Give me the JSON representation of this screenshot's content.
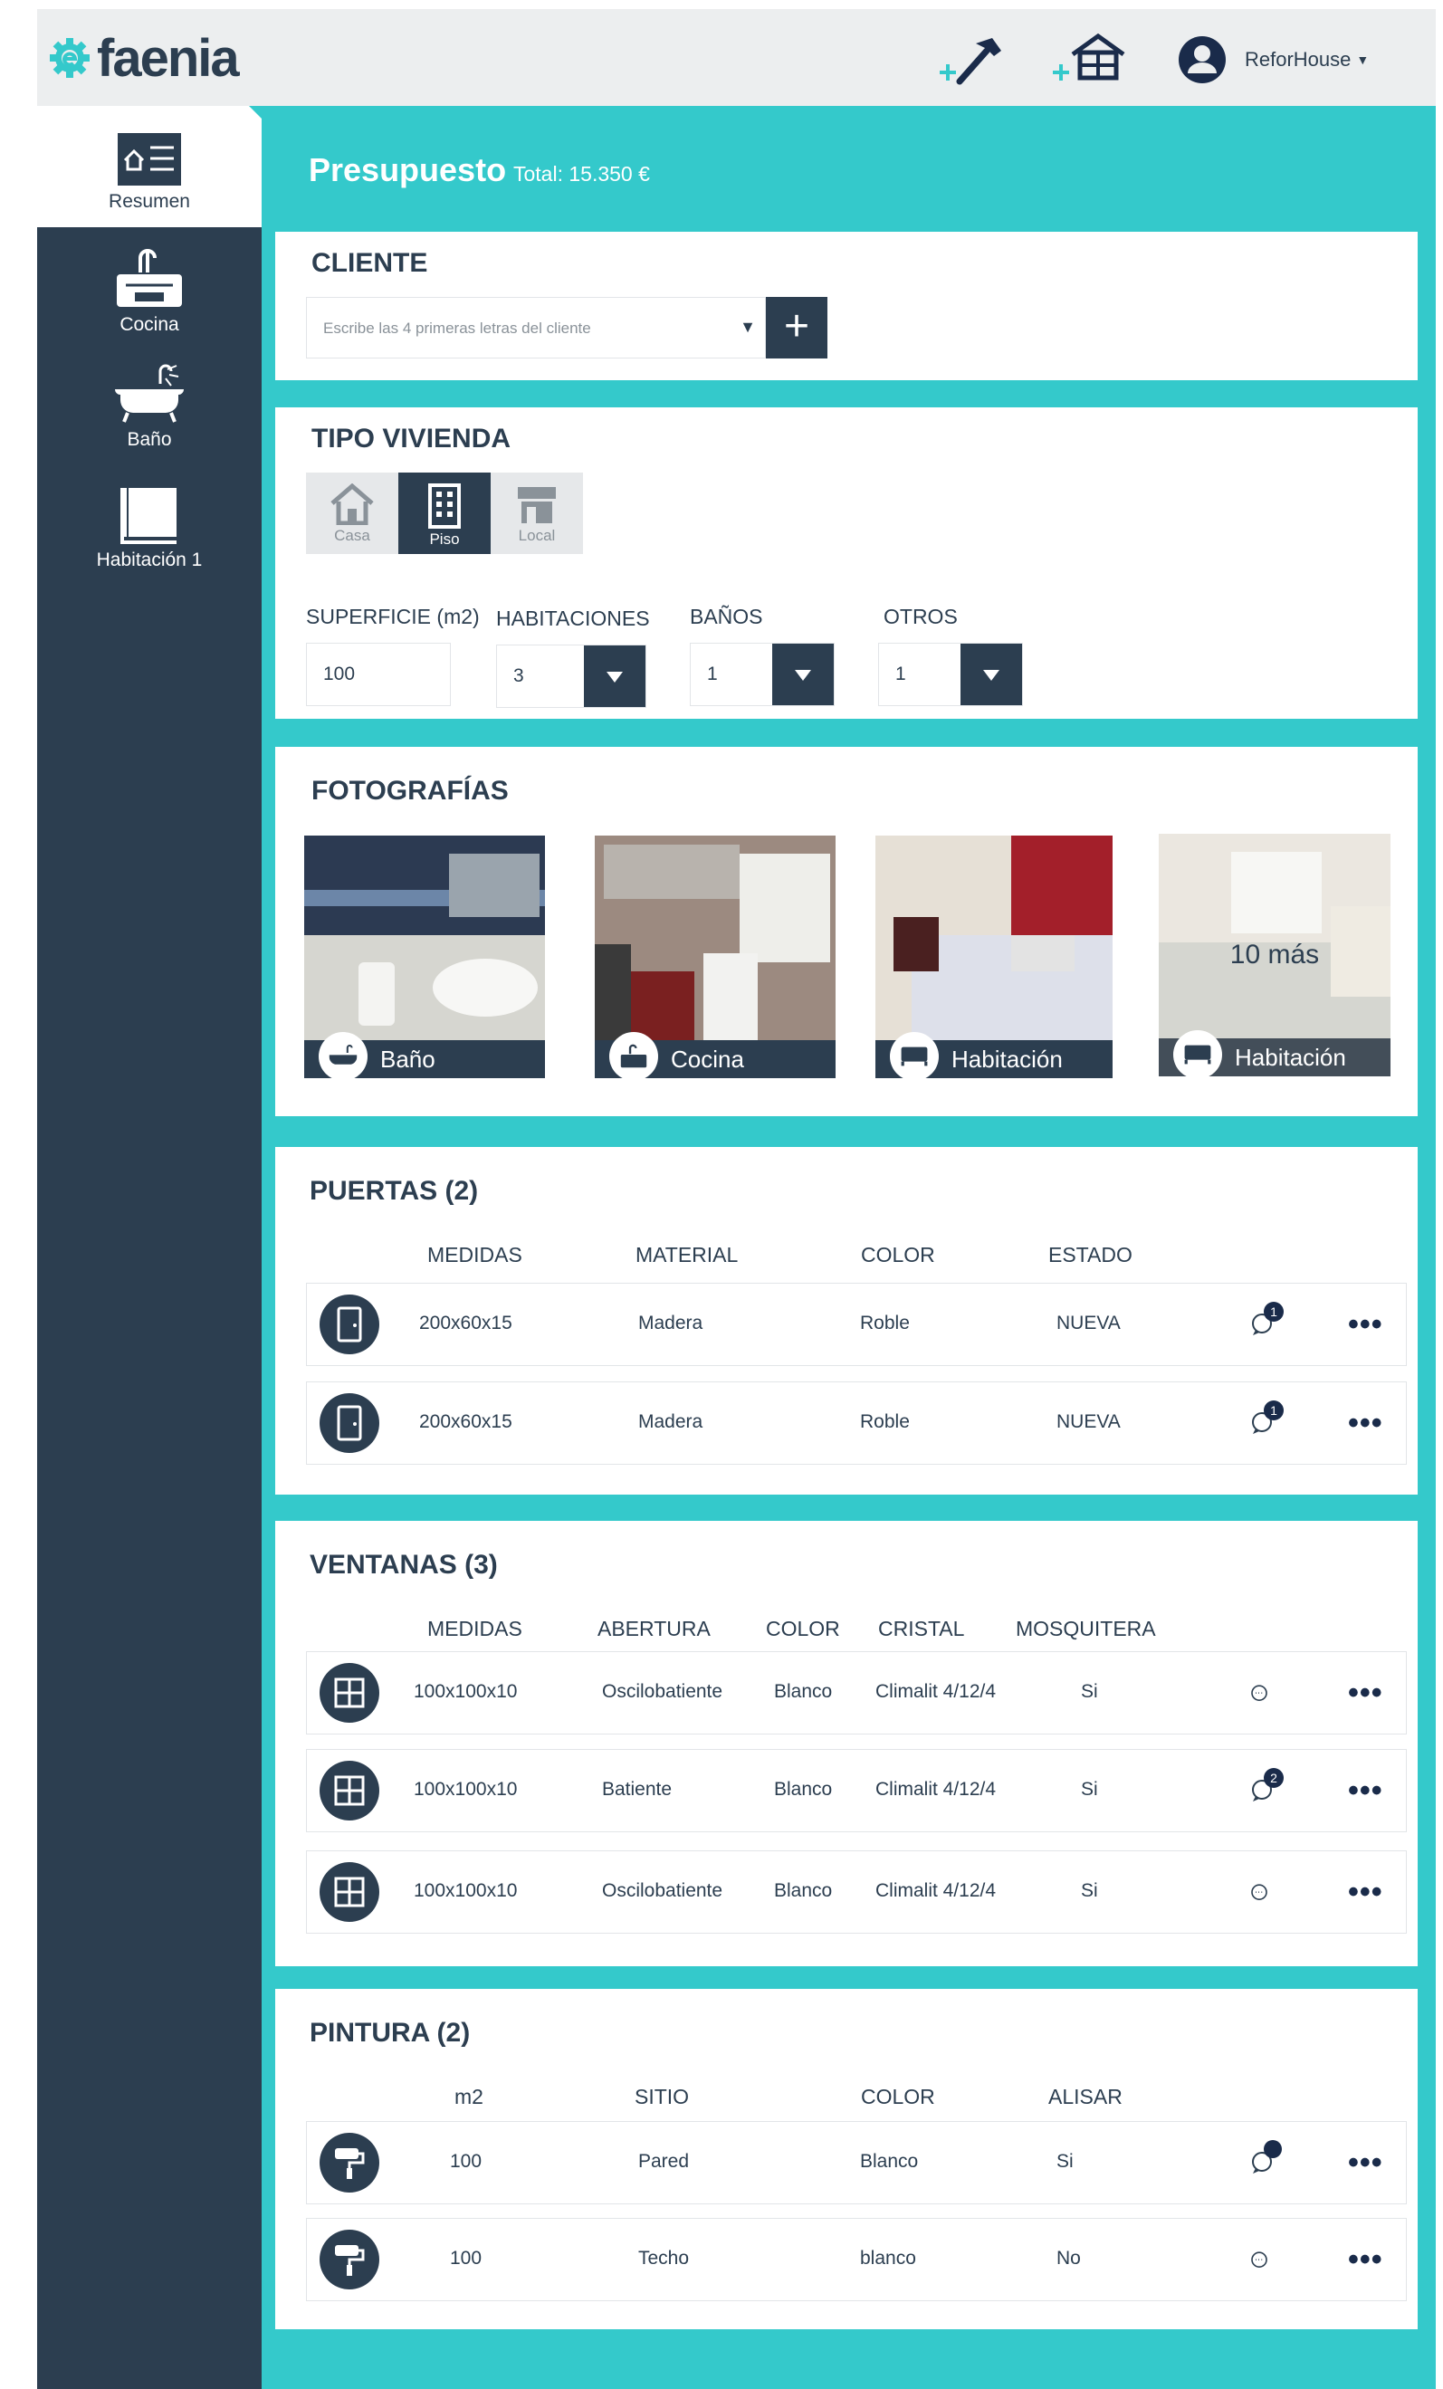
{
  "app": {
    "logo": "faenia",
    "user": "ReforHouse"
  },
  "sidebar": {
    "items": [
      {
        "label": "Resumen",
        "icon": "summary-icon"
      },
      {
        "label": "Cocina",
        "icon": "kitchen-sink-icon"
      },
      {
        "label": "Baño",
        "icon": "bathtub-icon"
      },
      {
        "label": "Habitación 1",
        "icon": "room-icon"
      }
    ]
  },
  "header": {
    "title": "Presupuesto",
    "total": "Total: 15.350 €"
  },
  "cliente": {
    "title": "CLIENTE",
    "placeholder": "Escribe las 4 primeras letras del cliente",
    "add": "+"
  },
  "vivienda": {
    "title": "TIPO VIVIENDA",
    "types": [
      {
        "label": "Casa",
        "selected": false
      },
      {
        "label": "Piso",
        "selected": true
      },
      {
        "label": "Local",
        "selected": false
      }
    ],
    "superficie_label": "SUPERFICIE (m2)",
    "superficie": "100",
    "habitaciones_label": "HABITACIONES",
    "habitaciones": "3",
    "banos_label": "BAÑOS",
    "banos": "1",
    "otros_label": "OTROS",
    "otros": "1"
  },
  "fotos": {
    "title": "FOTOGRAFÍAS",
    "items": [
      {
        "label": "Baño"
      },
      {
        "label": "Cocina"
      },
      {
        "label": "Habitación"
      },
      {
        "label": "Habitación"
      }
    ],
    "more": "10 más"
  },
  "puertas": {
    "title": "PUERTAS (2)",
    "headers": [
      "MEDIDAS",
      "MATERIAL",
      "COLOR",
      "ESTADO"
    ],
    "rows": [
      {
        "medidas": "200x60x15",
        "material": "Madera",
        "color": "Roble",
        "estado": "NUEVA",
        "comments": "1"
      },
      {
        "medidas": "200x60x15",
        "material": "Madera",
        "color": "Roble",
        "estado": "NUEVA",
        "comments": "1"
      }
    ]
  },
  "ventanas": {
    "title": "VENTANAS (3)",
    "headers": [
      "MEDIDAS",
      "ABERTURA",
      "COLOR",
      "CRISTAL",
      "MOSQUITERA"
    ],
    "rows": [
      {
        "medidas": "100x100x10",
        "abertura": "Oscilobatiente",
        "color": "Blanco",
        "cristal": "Climalit 4/12/4",
        "mosquitera": "Si",
        "comments": ""
      },
      {
        "medidas": "100x100x10",
        "abertura": "Batiente",
        "color": "Blanco",
        "cristal": "Climalit 4/12/4",
        "mosquitera": "Si",
        "comments": "2"
      },
      {
        "medidas": "100x100x10",
        "abertura": "Oscilobatiente",
        "color": "Blanco",
        "cristal": "Climalit 4/12/4",
        "mosquitera": "Si",
        "comments": ""
      }
    ]
  },
  "pintura": {
    "title": "PINTURA (2)",
    "headers": [
      "m2",
      "SITIO",
      "COLOR",
      "ALISAR"
    ],
    "rows": [
      {
        "m2": "100",
        "sitio": "Pared",
        "color": "Blanco",
        "alisar": "Si",
        "comments": ""
      },
      {
        "m2": "100",
        "sitio": "Techo",
        "color": "blanco",
        "alisar": "No",
        "comments": ""
      }
    ]
  },
  "colors": {
    "primary": "#2c3e50",
    "accent": "#34c9cb",
    "badge": "#1a2b4a"
  }
}
